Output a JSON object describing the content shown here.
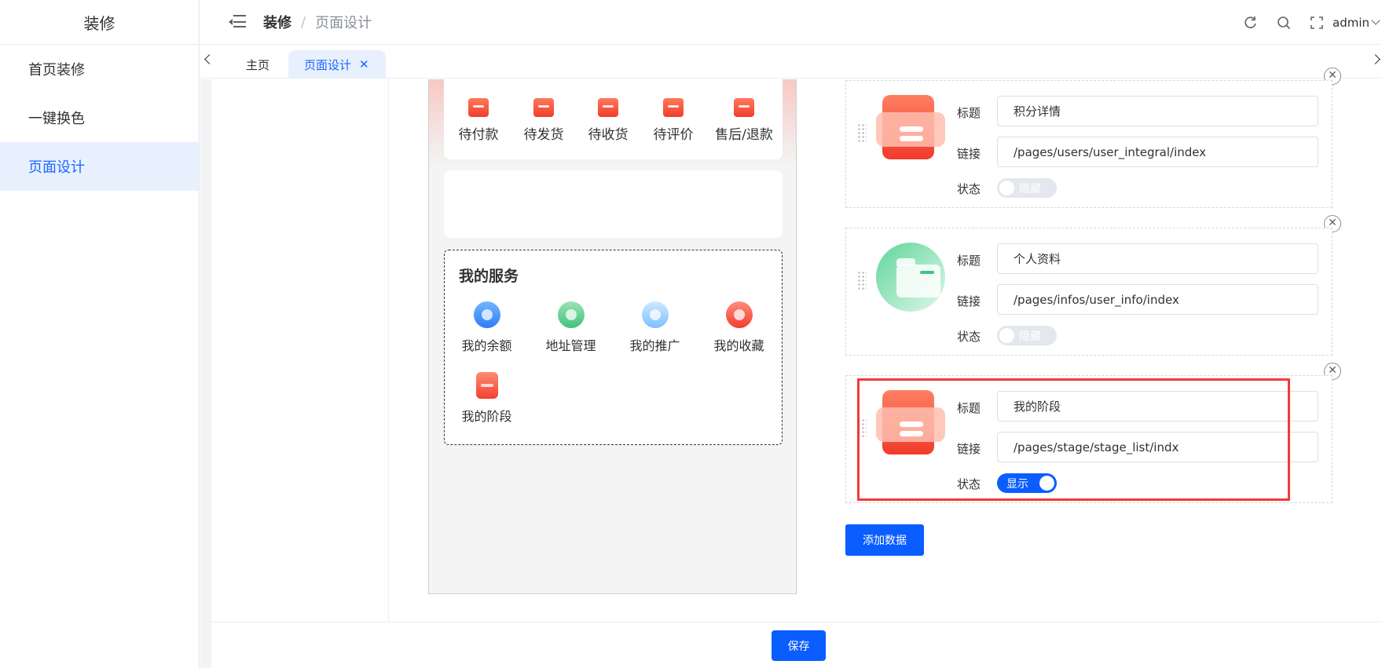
{
  "sidebar": {
    "brand": "装修",
    "items": [
      {
        "label": "首页装修"
      },
      {
        "label": "一键换色"
      },
      {
        "label": "页面设计"
      }
    ]
  },
  "header": {
    "breadcrumb": {
      "root": "装修",
      "separator": "/",
      "current": "页面设计"
    },
    "user": "admin"
  },
  "tabs": {
    "home": "主页",
    "current": "页面设计",
    "close": "✕"
  },
  "preview": {
    "orders": [
      {
        "label": "待付款",
        "icon": "wallet-icon"
      },
      {
        "label": "待发货",
        "icon": "truck-icon"
      },
      {
        "label": "待收货",
        "icon": "package-icon"
      },
      {
        "label": "待评价",
        "icon": "comment-icon"
      },
      {
        "label": "售后/退款",
        "icon": "refund-icon"
      }
    ],
    "services": {
      "title": "我的服务",
      "items": [
        {
          "label": "我的余额",
          "icon": "balance-icon"
        },
        {
          "label": "地址管理",
          "icon": "location-icon"
        },
        {
          "label": "我的推广",
          "icon": "promotion-icon"
        },
        {
          "label": "我的收藏",
          "icon": "favorite-icon"
        },
        {
          "label": "我的阶段",
          "icon": "stage-icon"
        }
      ]
    }
  },
  "editor": {
    "labels": {
      "title": "标题",
      "link": "链接",
      "status": "状态"
    },
    "items": [
      {
        "title": "积分详情",
        "link": "/pages/users/user_integral/index",
        "status": "隐藏",
        "enabled": false,
        "thumb": "printer-icon"
      },
      {
        "title": "个人资料",
        "link": "/pages/infos/user_info/index",
        "status": "隐藏",
        "enabled": false,
        "thumb": "folder-icon"
      },
      {
        "title": "我的阶段",
        "link": "/pages/stage/stage_list/indx",
        "status": "显示",
        "enabled": true,
        "thumb": "printer-icon"
      }
    ],
    "add_label": "添加数据"
  },
  "footer": {
    "save_label": "保存"
  },
  "colors": {
    "primary": "#0a5dff",
    "highlight": "#ef3b3b",
    "active_bg": "#e8f0fe"
  }
}
